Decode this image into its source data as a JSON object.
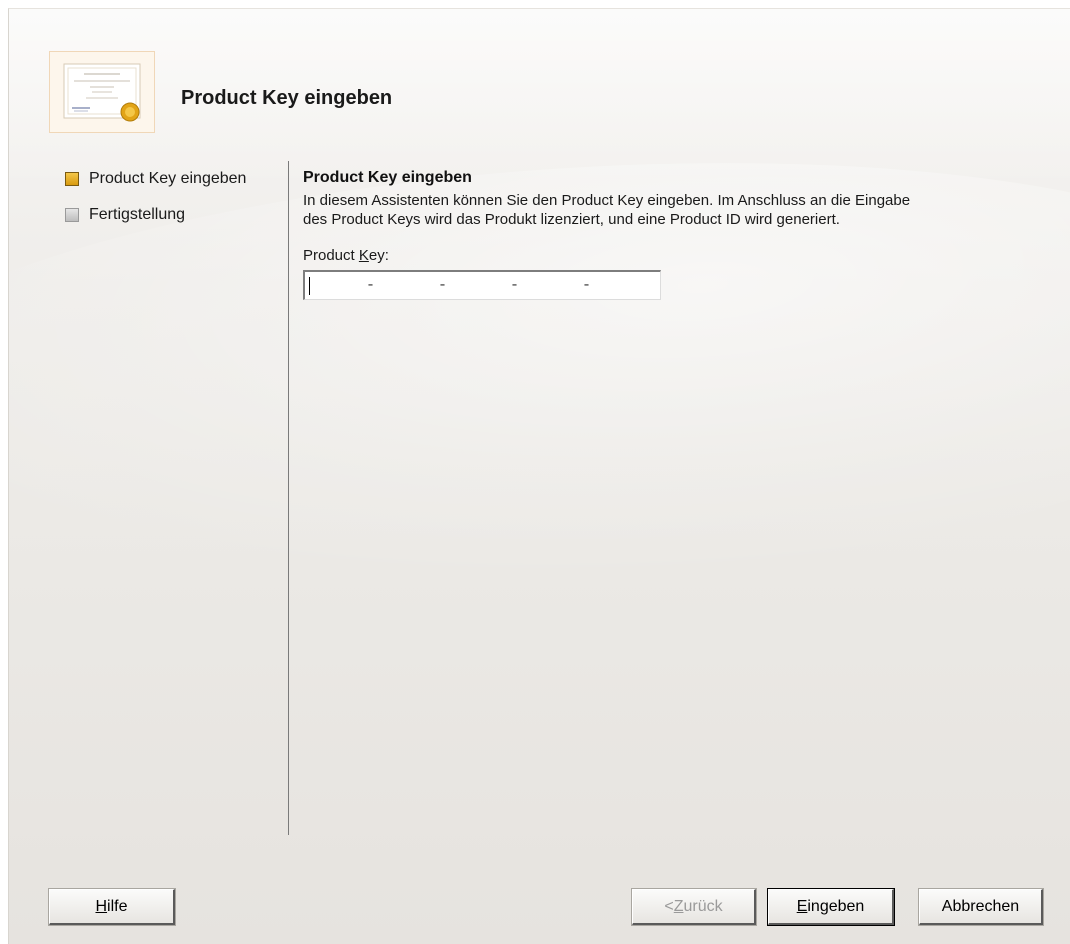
{
  "header": {
    "title": "Product Key eingeben",
    "icon": "certificate-icon"
  },
  "steps": [
    {
      "label": "Product Key eingeben",
      "state": "active",
      "color": "#e8b429"
    },
    {
      "label": "Fertigstellung",
      "state": "pending",
      "color": "#c8c8c8"
    }
  ],
  "content": {
    "title": "Product Key eingeben",
    "description_line1": "In diesem Assistenten können Sie den Product Key eingeben. Im Anschluss an die Eingabe",
    "description_line2": "des Product Keys wird das Produkt lizenziert, und eine Product ID wird generiert.",
    "field_label_prefix": "Product ",
    "field_label_mnemonic": "K",
    "field_label_suffix": "ey:",
    "key_value": "",
    "key_separator": "-"
  },
  "buttons": {
    "help": {
      "mnemonic": "H",
      "rest": "ilfe"
    },
    "back": {
      "prefix": "< ",
      "mnemonic": "Z",
      "rest": "urück",
      "enabled": false
    },
    "enter": {
      "mnemonic": "E",
      "rest": "ingeben"
    },
    "cancel": {
      "label": "Abbrechen"
    }
  }
}
